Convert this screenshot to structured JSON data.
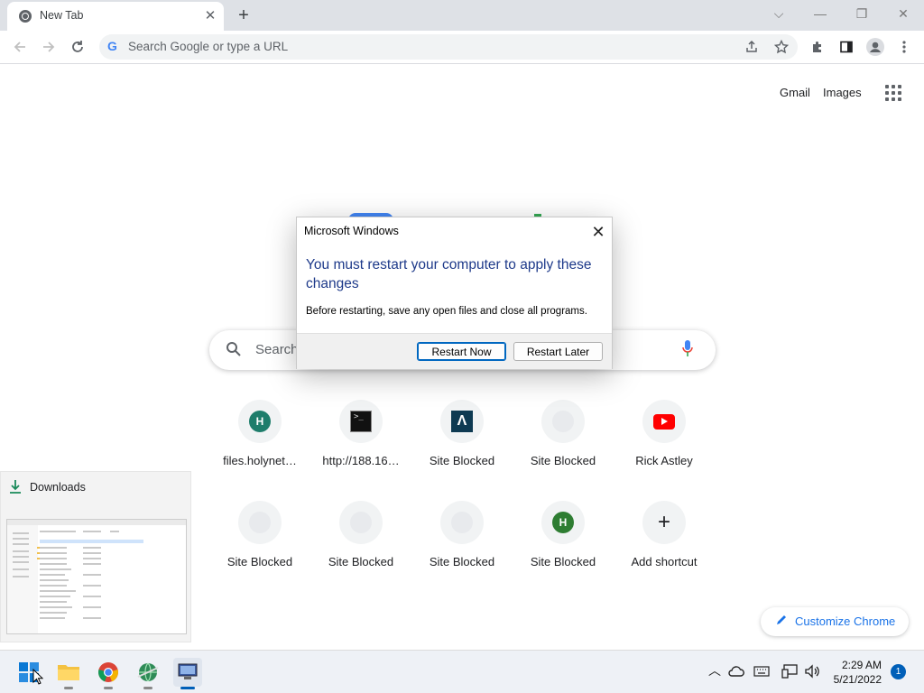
{
  "browser": {
    "tab_title": "New Tab",
    "tab_close": "✕",
    "new_tab": "+",
    "omnibox_placeholder": "Search Google or type a URL",
    "window_controls": {
      "dropdown": "⌵",
      "minimize": "—",
      "restore": "❐",
      "close": "✕"
    }
  },
  "header": {
    "gmail": "Gmail",
    "images": "Images"
  },
  "search": {
    "placeholder": "Search"
  },
  "shortcuts": [
    {
      "label": "files.holynet…",
      "icon": "H",
      "color": "#1e7d6b"
    },
    {
      "label": "http://188.16…",
      "icon": ">_"
    },
    {
      "label": "Site Blocked",
      "icon": "Λ"
    },
    {
      "label": "Site Blocked"
    },
    {
      "label": "Rick Astley"
    },
    {
      "label": "Site Blocked"
    },
    {
      "label": "Site Blocked"
    },
    {
      "label": "Site Blocked"
    },
    {
      "label": "Site Blocked",
      "icon": "H",
      "color": "#2e7d32"
    },
    {
      "label": "Add shortcut",
      "icon": "+"
    }
  ],
  "customize": {
    "label": "Customize Chrome"
  },
  "downloads": {
    "title": "Downloads"
  },
  "dialog": {
    "caption": "Microsoft Windows",
    "close": "✕",
    "main_instruction": "You must restart your computer to apply these changes",
    "content": "Before restarting, save any open files and close all programs.",
    "restart_now": "Restart Now",
    "restart_later": "Restart Later"
  },
  "taskbar": {
    "time": "2:29 AM",
    "date": "5/21/2022",
    "notifications": "1",
    "tray_chevron": "︿"
  },
  "colors": {
    "accent": "#1a73e8",
    "dialog_text": "#1e3a8a",
    "windows_blue": "#0067c0"
  }
}
